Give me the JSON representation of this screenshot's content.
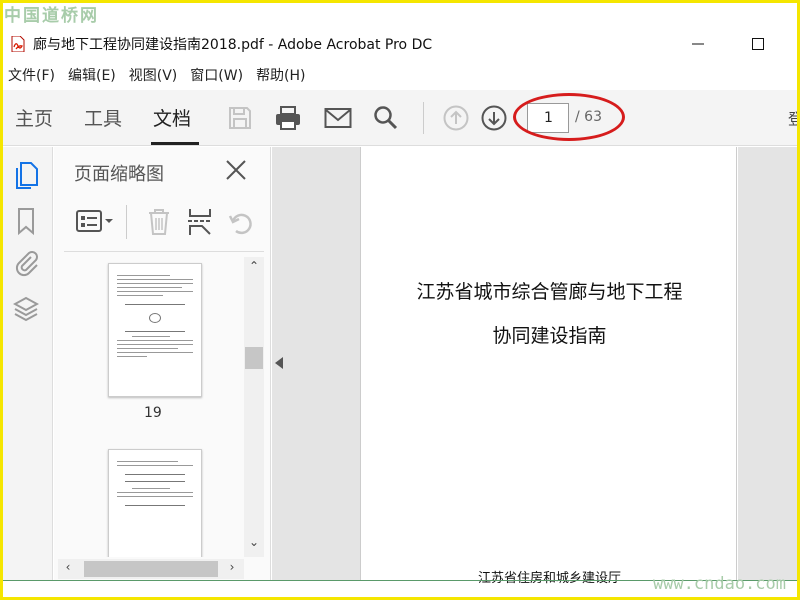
{
  "watermarks": {
    "top": "中国道桥网",
    "bottom": "www.cndao.com"
  },
  "window": {
    "title": "廊与地下工程协同建设指南2018.pdf - Adobe Acrobat Pro DC",
    "minimize_icon": "minimize-icon",
    "maximize_icon": "maximize-icon"
  },
  "menu": {
    "items": [
      "文件(F)",
      "编辑(E)",
      "视图(V)",
      "窗口(W)",
      "帮助(H)"
    ]
  },
  "toolbar": {
    "tabs": [
      "主页",
      "工具",
      "文档"
    ],
    "active_tab": "文档",
    "page_current": "1",
    "page_total": "/ 63",
    "right_edge_text": "登",
    "icons": [
      "save-icon",
      "print-icon",
      "email-icon",
      "search-icon",
      "page-up-icon",
      "page-down-icon"
    ],
    "highlight_color": "#d61c1c"
  },
  "leftrail": {
    "icons": [
      "page-thumbnails-icon",
      "bookmarks-icon",
      "attachments-icon",
      "layers-icon"
    ],
    "active_color": "#1473e6"
  },
  "panel": {
    "title": "页面缩略图",
    "tools": [
      "thumbnail-options-icon",
      "delete-page-icon",
      "extract-page-icon",
      "rotate-page-icon"
    ],
    "thumbnails": [
      {
        "label": "19"
      },
      {
        "label": ""
      }
    ]
  },
  "document": {
    "title_line1": "江苏省城市综合管廊与地下工程",
    "title_line2": "协同建设指南",
    "footer": "江苏省住房和城乡建设厅"
  }
}
